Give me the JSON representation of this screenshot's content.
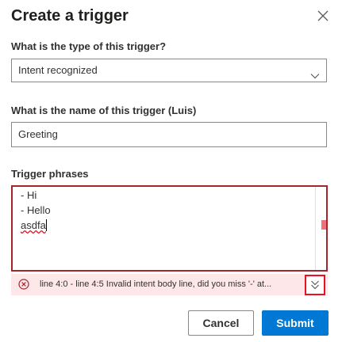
{
  "dialog": {
    "title": "Create a trigger",
    "close_icon": "close-icon"
  },
  "trigger_type": {
    "label": "What is the type of this trigger?",
    "value": "Intent recognized",
    "chevron_icon": "chevron-down-icon"
  },
  "trigger_name": {
    "label": "What is the name of this trigger (Luis)",
    "value": "Greeting"
  },
  "trigger_phrases": {
    "label": "Trigger phrases",
    "lines": [
      "- Hi",
      "- Hello",
      "asdfa"
    ]
  },
  "error": {
    "icon": "error-circle-icon",
    "message": "line 4:0 - line 4:5 Invalid intent body line, did you miss '-' at...",
    "expand_icon": "double-chevron-down-icon"
  },
  "footer": {
    "cancel_label": "Cancel",
    "submit_label": "Submit"
  },
  "colors": {
    "primary": "#0078d4",
    "error_border": "#a4262c",
    "error_background": "#fde7e9",
    "error_highlight": "#e81123"
  }
}
